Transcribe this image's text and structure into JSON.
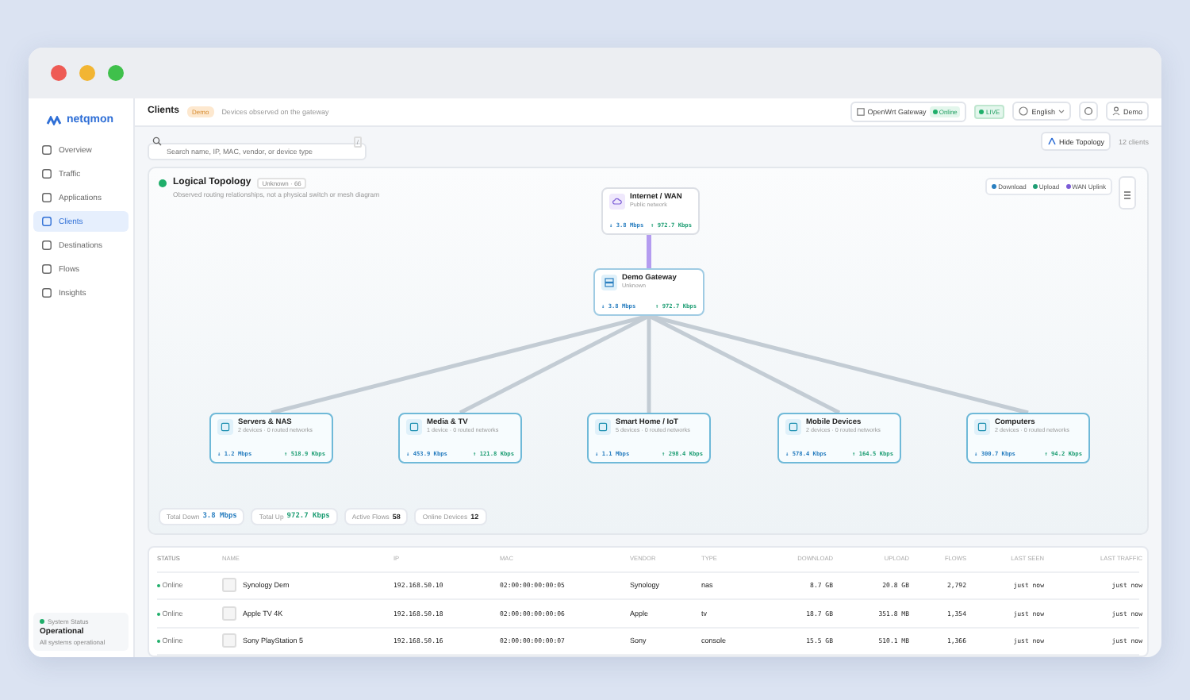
{
  "sidebar": {
    "logo": "netqmon",
    "items": [
      {
        "label": "Overview",
        "selected": false
      },
      {
        "label": "Traffic",
        "selected": false
      },
      {
        "label": "Applications",
        "selected": false
      },
      {
        "label": "Clients",
        "selected": true
      },
      {
        "label": "Destinations",
        "selected": false
      },
      {
        "label": "Flows",
        "selected": false
      },
      {
        "label": "Insights",
        "selected": false
      }
    ],
    "status": {
      "label": "System Status",
      "value": "Operational",
      "detail": "All systems operational"
    }
  },
  "header": {
    "title": "Clients",
    "badge": "Demo",
    "subtitle": "Devices observed on the gateway",
    "gateway": "OpenWrt Gateway",
    "gateway_status": "Online",
    "live": "LIVE",
    "language": "English",
    "user": "Demo"
  },
  "search": {
    "placeholder": "Search name, IP, MAC, vendor, or device type",
    "shortcut": "/"
  },
  "toolbar": {
    "toggle": "Hide Topology",
    "count": "12 clients"
  },
  "topology": {
    "title": "Logical Topology",
    "badge": "Unknown · 66",
    "subtitle": "Observed routing relationships, not a physical switch or mesh diagram",
    "legend": [
      {
        "label": "Download",
        "color": "#2a7fc0"
      },
      {
        "label": "Upload",
        "color": "#1f9e74"
      },
      {
        "label": "WAN Uplink",
        "color": "#7b5cd6"
      }
    ],
    "internet": {
      "name": "Internet / WAN",
      "sub": "Public network",
      "down": "↓ 3.8 Mbps",
      "up": "↑ 972.7 Kbps"
    },
    "gateway": {
      "name": "Demo Gateway",
      "sub": "Unknown",
      "down": "↓ 3.8 Mbps",
      "up": "↑ 972.7 Kbps"
    },
    "groups": [
      {
        "name": "Servers & NAS",
        "sub": "2 devices · 0 routed networks",
        "down": "↓ 1.2 Mbps",
        "up": "↑ 518.9 Kbps"
      },
      {
        "name": "Media & TV",
        "sub": "1 device · 0 routed networks",
        "down": "↓ 453.9 Kbps",
        "up": "↑ 121.8 Kbps"
      },
      {
        "name": "Smart Home / IoT",
        "sub": "5 devices · 0 routed networks",
        "down": "↓ 1.1 Mbps",
        "up": "↑ 298.4 Kbps"
      },
      {
        "name": "Mobile Devices",
        "sub": "2 devices · 0 routed networks",
        "down": "↓ 578.4 Kbps",
        "up": "↑ 164.5 Kbps"
      },
      {
        "name": "Computers",
        "sub": "2 devices · 0 routed networks",
        "down": "↓ 300.7 Kbps",
        "up": "↑ 94.2 Kbps"
      }
    ],
    "stats": [
      {
        "label": "Total Down",
        "value": "3.8 Mbps",
        "kind": "down"
      },
      {
        "label": "Total Up",
        "value": "972.7 Kbps",
        "kind": "up"
      },
      {
        "label": "Active Flows",
        "value": "58",
        "kind": "plain"
      },
      {
        "label": "Online Devices",
        "value": "12",
        "kind": "plain"
      }
    ]
  },
  "table": {
    "columns": [
      "STATUS",
      "NAME",
      "IP",
      "MAC",
      "VENDOR",
      "TYPE",
      "DOWNLOAD",
      "UPLOAD",
      "FLOWS",
      "LAST SEEN",
      "LAST TRAFFIC"
    ],
    "rows": [
      {
        "status": "Online",
        "name": "Synology Dem",
        "ip": "192.168.50.10",
        "mac": "02:00:00:00:00:05",
        "vendor": "Synology",
        "type": "nas",
        "download": "8.7 GB",
        "upload": "20.8 GB",
        "flows": "2,792",
        "last_seen": "just now",
        "last_traffic": "just now"
      },
      {
        "status": "Online",
        "name": "Apple TV 4K",
        "ip": "192.168.50.18",
        "mac": "02:00:00:00:00:06",
        "vendor": "Apple",
        "type": "tv",
        "download": "18.7 GB",
        "upload": "351.8 MB",
        "flows": "1,354",
        "last_seen": "just now",
        "last_traffic": "just now"
      },
      {
        "status": "Online",
        "name": "Sony PlayStation 5",
        "ip": "192.168.50.16",
        "mac": "02:00:00:00:00:07",
        "vendor": "Sony",
        "type": "console",
        "download": "15.5 GB",
        "upload": "510.1 MB",
        "flows": "1,366",
        "last_seen": "just now",
        "last_traffic": "just now"
      }
    ]
  }
}
